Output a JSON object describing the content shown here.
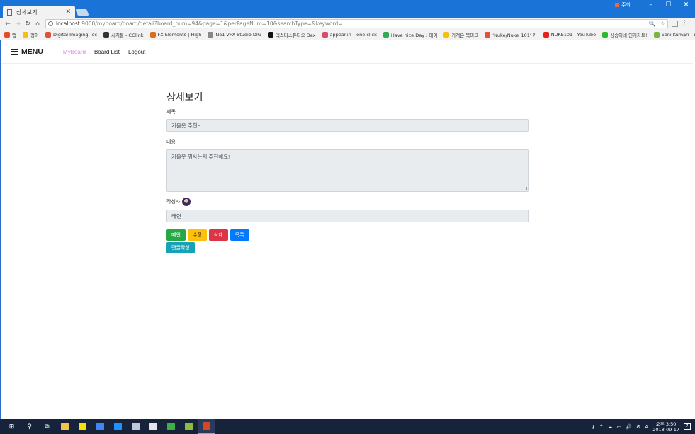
{
  "browser": {
    "tab_title": "상세보기",
    "tab_close": "✕",
    "user_label": "주희",
    "window_buttons": [
      "–",
      "☐",
      "✕"
    ],
    "url_host": "localhost",
    "url_rest": ":9000/myboard/board/detail?board_num=94&page=1&perPageNum=10&searchType=&keyword=",
    "nav": {
      "back": "←",
      "forward": "→",
      "reload": "↻",
      "home": "⌂"
    },
    "tools": {
      "zoom": "🔍",
      "star": "☆",
      "menu": "⋮"
    }
  },
  "bookmarks": [
    {
      "label": "앱",
      "color": "#e44d26"
    },
    {
      "label": "정아",
      "color": "#f4c20d"
    },
    {
      "label": "Digital Imaging Tec",
      "color": "#e0533b"
    },
    {
      "label": "서치툴 - CGlink",
      "color": "#333333"
    },
    {
      "label": "FX Elements | High",
      "color": "#e06a1b"
    },
    {
      "label": "No1 VFX Studio DIG",
      "color": "#888888"
    },
    {
      "label": "덱스터스튜디오 Dex",
      "color": "#111111"
    },
    {
      "label": "appear.in – one click",
      "color": "#d94a6b"
    },
    {
      "label": "Have nice Day : 데이",
      "color": "#34a853"
    },
    {
      "label": "가져온 북마크",
      "color": "#f4c20d"
    },
    {
      "label": "'Nuke/Nuke_101' 카",
      "color": "#e0533b"
    },
    {
      "label": "NUKE101 - YouTube",
      "color": "#e62117"
    },
    {
      "label": "상승이네 인기차트!",
      "color": "#2eb82e"
    },
    {
      "label": "Soni Kumari - Envat",
      "color": "#7cb342"
    }
  ],
  "bookmarks_more": "»",
  "navbar": {
    "brand": "MENU",
    "links": [
      "MyBoard",
      "Board List",
      "Logout"
    ]
  },
  "detail": {
    "heading": "상세보기",
    "title_label": "제목",
    "title_value": "가을옷 추천~",
    "content_label": "내용",
    "content_value": "가을옷 뭐사는지 추천해요!",
    "writer_label": "작성자",
    "writer_value": "태연",
    "buttons": {
      "main": "메인",
      "edit": "수정",
      "delete": "삭제",
      "list": "목록",
      "reply": "댓글작성"
    }
  },
  "taskbar": {
    "start": "⊞",
    "search": "⚲",
    "task_view": "⧉",
    "apps": [
      {
        "name": "file-explorer",
        "color": "#f2c14e"
      },
      {
        "name": "kakaotalk",
        "color": "#f9e000"
      },
      {
        "name": "chrome",
        "color": "#4285f4"
      },
      {
        "name": "edge",
        "color": "#1e90ff"
      },
      {
        "name": "app-cloud",
        "color": "#c0c8d8"
      },
      {
        "name": "app-notepad",
        "color": "#e6e6e6"
      },
      {
        "name": "app-green",
        "color": "#3cb043"
      },
      {
        "name": "app-bird",
        "color": "#8fbc3f"
      },
      {
        "name": "powerpoint",
        "color": "#d24726"
      }
    ],
    "tray_icons": [
      "⚷",
      "^",
      "☁",
      "▭",
      "🔊",
      "⚙",
      "A"
    ],
    "time": "오후 3:50",
    "date": "2018-09-17",
    "notifications": "7"
  }
}
